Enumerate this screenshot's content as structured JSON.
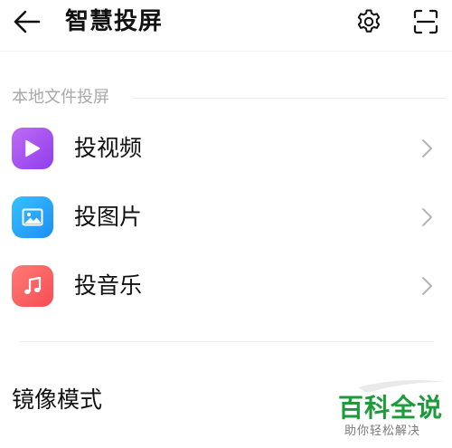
{
  "header": {
    "title": "智慧投屏",
    "back_icon": "arrow-left-icon",
    "settings_icon": "gear-icon",
    "scan_icon": "scan-icon"
  },
  "local_section": {
    "label": "本地文件投屏",
    "items": [
      {
        "label": "投视频",
        "icon": "play-icon",
        "color": "#a855f7"
      },
      {
        "label": "投图片",
        "icon": "image-icon",
        "color": "#29a8fb"
      },
      {
        "label": "投音乐",
        "icon": "music-note-icon",
        "color": "#f7605f"
      }
    ]
  },
  "mirror": {
    "label": "镜像模式"
  },
  "watermark": {
    "title": "百科全说",
    "subtitle": "助你轻松解决",
    "color": "#1f9a3b"
  }
}
